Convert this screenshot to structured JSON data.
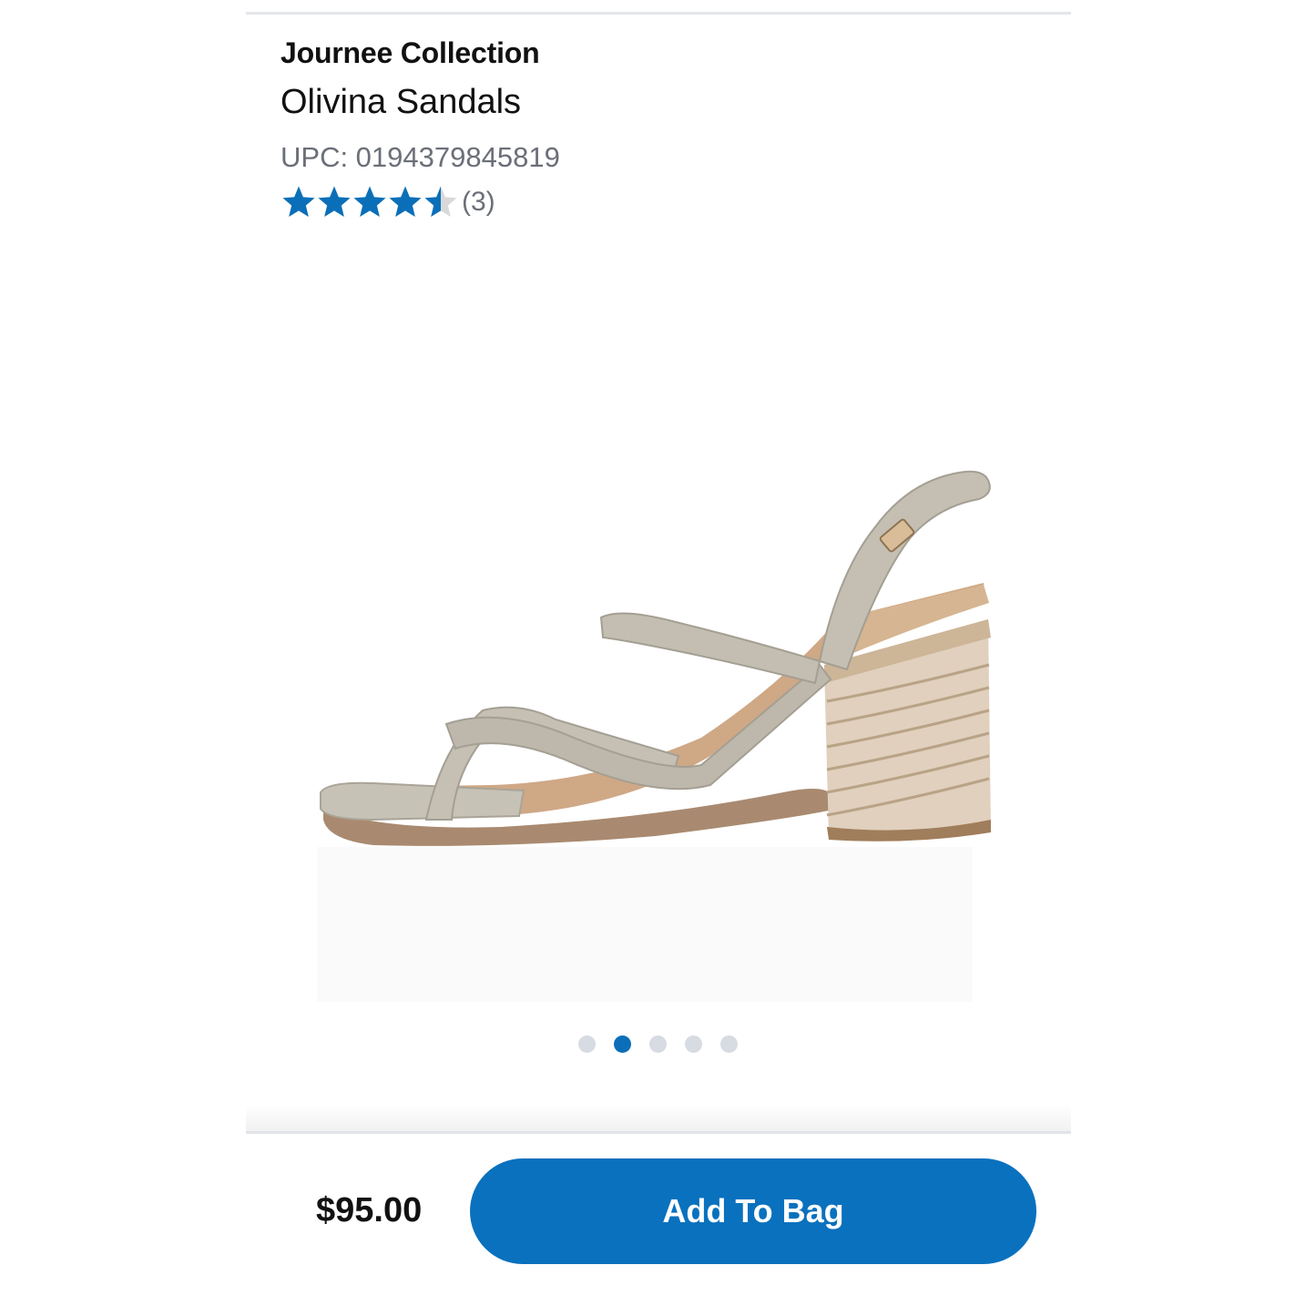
{
  "product": {
    "brand": "Journee Collection",
    "name": "Olivina Sandals",
    "upc": "UPC: 0194379845819"
  },
  "rating": {
    "value": 4.5,
    "max": 5,
    "count_label": "(3)",
    "star_color": "#0a6fb8",
    "empty_star_color": "#d9d9d9"
  },
  "gallery": {
    "image_icon": "sandal-product-image",
    "slide_count": 5,
    "active_index": 1,
    "active_color": "#0a6fb8",
    "inactive_color": "#d7dbe2"
  },
  "purchase": {
    "price": "$95.00",
    "add_to_bag_label": "Add To Bag",
    "button_color": "#0a71be"
  }
}
